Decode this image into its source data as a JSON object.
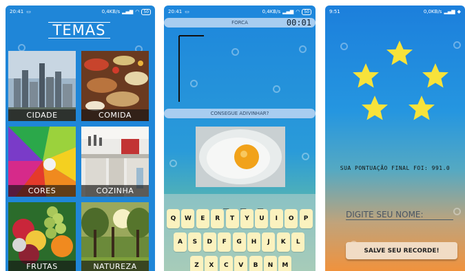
{
  "screen1": {
    "status": {
      "time": "20:41",
      "speed": "0,4KB/s",
      "battery": "50"
    },
    "title": "TEMAS",
    "themes": [
      {
        "label": "CIDADE"
      },
      {
        "label": "COMIDA"
      },
      {
        "label": "CORES"
      },
      {
        "label": "COZINHA"
      },
      {
        "label": "FRUTAS"
      },
      {
        "label": "NATUREZA"
      }
    ]
  },
  "screen2": {
    "status": {
      "time": "20:41",
      "speed": "0,4KB/s",
      "battery": "50"
    },
    "mode_label": "FORCA",
    "timer": "00:01",
    "prompt": "CONSEGUE ADIVINHAR?",
    "blanks": "_ _ _",
    "keyboard_rows": [
      [
        "Q",
        "W",
        "E",
        "R",
        "T",
        "Y",
        "U",
        "I",
        "O",
        "P"
      ],
      [
        "A",
        "S",
        "D",
        "F",
        "G",
        "H",
        "J",
        "K",
        "L"
      ],
      [
        "Z",
        "X",
        "C",
        "V",
        "B",
        "N",
        "M"
      ]
    ]
  },
  "screen3": {
    "status": {
      "time": "9:51",
      "speed": "0,0KB/s"
    },
    "score_text": "SUA PONTUAÇÃO FINAL FOI: 991.0",
    "name_placeholder": "DIGITE SEU NOME:",
    "save_label": "SALVE SEU RECORDE!",
    "stars_count": 5
  },
  "colors": {
    "background_blue": "#1f86d8",
    "key_fill": "#fbf2bf",
    "star": "#f7e23a",
    "save_button": "#f1dcc5"
  }
}
